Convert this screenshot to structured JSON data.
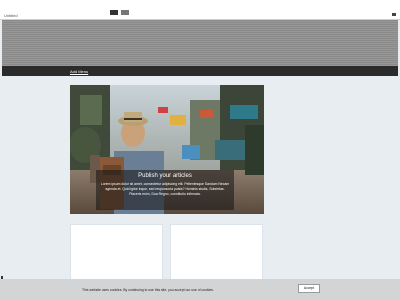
{
  "window": {
    "tab_label": "Untitled",
    "colors": {
      "header": "#8f8f8f",
      "navbar": "#2b2b2b",
      "background": "#e8edf2",
      "cookie_bar": "#d2d4d6"
    }
  },
  "nav": {
    "menu_label": "Add Menu"
  },
  "feature": {
    "title": "Publish your articles",
    "text": "Lorem ipsum dolor sit amet, consectetur adipiscing elit. Pellentesque Sandum Necam agenda et. Quid igitur inque, sed responsoria pulsis? Hominis studis, Sobrietas. Placeris enim, Dua Regno, constitutio infirmata."
  },
  "cookie": {
    "text": "This website uses cookies. By continuing to use this site, you accept our use of cookies.",
    "accept_label": "Accept"
  }
}
